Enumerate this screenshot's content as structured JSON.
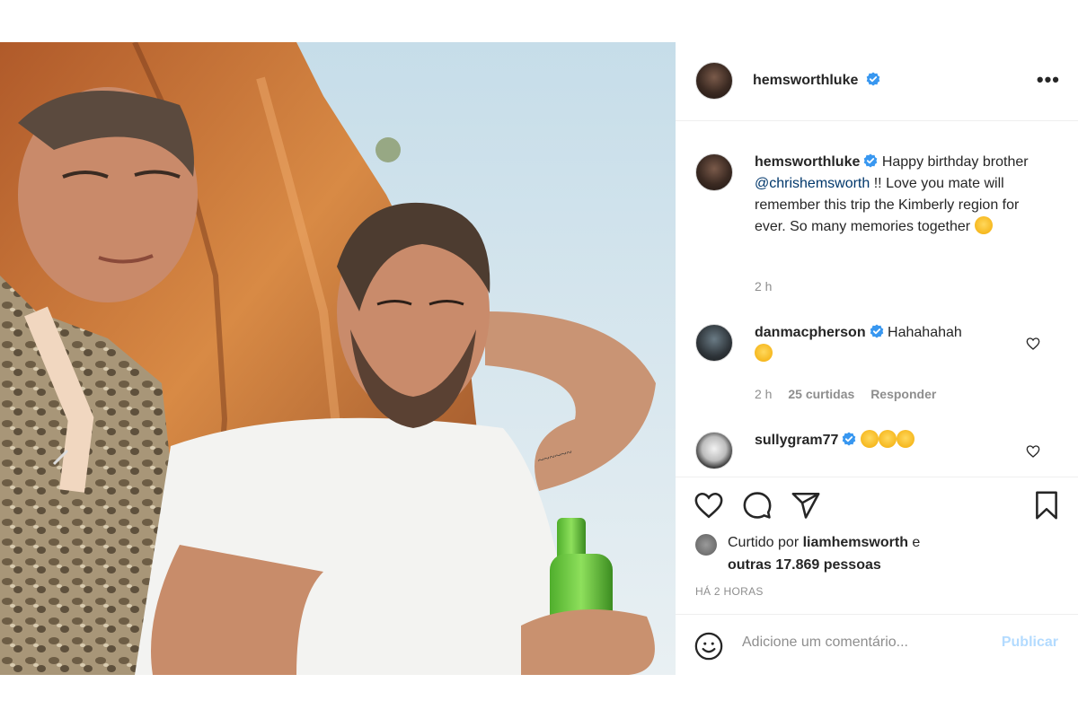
{
  "post": {
    "username": "hemsworthluke",
    "more_icon": "more-horizontal-icon"
  },
  "caption": {
    "username": "hemsworthluke",
    "text_before": "Happy birthday brother ",
    "mention": "@chrishemsworth",
    "text_after": " !! Love you mate will remember this trip the Kimberly region for ever. So many memories together",
    "time": "2 h"
  },
  "comments": [
    {
      "username": "danmacpherson",
      "text": "Hahahahah",
      "time": "2 h",
      "likes": "25 curtidas",
      "reply": "Responder"
    },
    {
      "username": "sullygram77",
      "text": ""
    }
  ],
  "likes": {
    "prefix": "Curtido por",
    "user": "liamhemsworth",
    "conj": "e",
    "others": "outras 17.869 pessoas"
  },
  "posted_ago": "HÁ 2 HORAS",
  "add_comment": {
    "placeholder": "Adicione um comentário...",
    "publish": "Publicar"
  },
  "colors": {
    "verified": "#3897f0",
    "mention": "#00376b",
    "publish_disabled": "#b3dbff"
  }
}
